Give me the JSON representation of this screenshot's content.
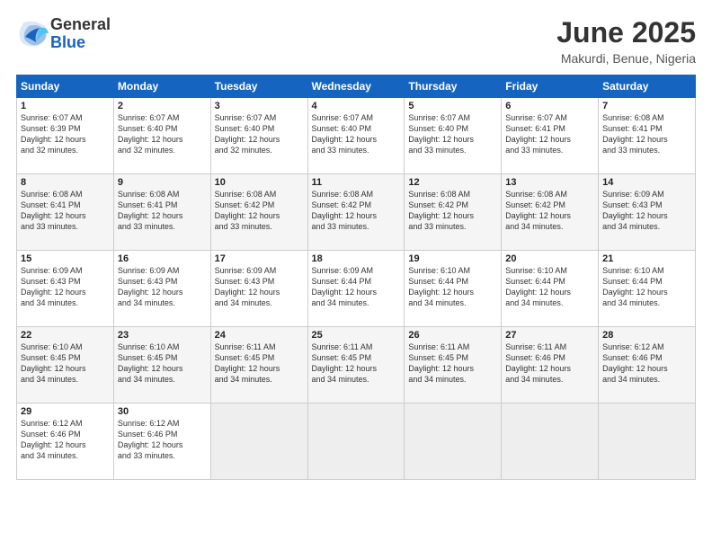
{
  "header": {
    "logo_general": "General",
    "logo_blue": "Blue",
    "month_year": "June 2025",
    "location": "Makurdi, Benue, Nigeria"
  },
  "days_of_week": [
    "Sunday",
    "Monday",
    "Tuesday",
    "Wednesday",
    "Thursday",
    "Friday",
    "Saturday"
  ],
  "weeks": [
    [
      {
        "day": "1",
        "info": "Sunrise: 6:07 AM\nSunset: 6:39 PM\nDaylight: 12 hours\nand 32 minutes."
      },
      {
        "day": "2",
        "info": "Sunrise: 6:07 AM\nSunset: 6:40 PM\nDaylight: 12 hours\nand 32 minutes."
      },
      {
        "day": "3",
        "info": "Sunrise: 6:07 AM\nSunset: 6:40 PM\nDaylight: 12 hours\nand 32 minutes."
      },
      {
        "day": "4",
        "info": "Sunrise: 6:07 AM\nSunset: 6:40 PM\nDaylight: 12 hours\nand 33 minutes."
      },
      {
        "day": "5",
        "info": "Sunrise: 6:07 AM\nSunset: 6:40 PM\nDaylight: 12 hours\nand 33 minutes."
      },
      {
        "day": "6",
        "info": "Sunrise: 6:07 AM\nSunset: 6:41 PM\nDaylight: 12 hours\nand 33 minutes."
      },
      {
        "day": "7",
        "info": "Sunrise: 6:08 AM\nSunset: 6:41 PM\nDaylight: 12 hours\nand 33 minutes."
      }
    ],
    [
      {
        "day": "8",
        "info": "Sunrise: 6:08 AM\nSunset: 6:41 PM\nDaylight: 12 hours\nand 33 minutes."
      },
      {
        "day": "9",
        "info": "Sunrise: 6:08 AM\nSunset: 6:41 PM\nDaylight: 12 hours\nand 33 minutes."
      },
      {
        "day": "10",
        "info": "Sunrise: 6:08 AM\nSunset: 6:42 PM\nDaylight: 12 hours\nand 33 minutes."
      },
      {
        "day": "11",
        "info": "Sunrise: 6:08 AM\nSunset: 6:42 PM\nDaylight: 12 hours\nand 33 minutes."
      },
      {
        "day": "12",
        "info": "Sunrise: 6:08 AM\nSunset: 6:42 PM\nDaylight: 12 hours\nand 33 minutes."
      },
      {
        "day": "13",
        "info": "Sunrise: 6:08 AM\nSunset: 6:42 PM\nDaylight: 12 hours\nand 34 minutes."
      },
      {
        "day": "14",
        "info": "Sunrise: 6:09 AM\nSunset: 6:43 PM\nDaylight: 12 hours\nand 34 minutes."
      }
    ],
    [
      {
        "day": "15",
        "info": "Sunrise: 6:09 AM\nSunset: 6:43 PM\nDaylight: 12 hours\nand 34 minutes."
      },
      {
        "day": "16",
        "info": "Sunrise: 6:09 AM\nSunset: 6:43 PM\nDaylight: 12 hours\nand 34 minutes."
      },
      {
        "day": "17",
        "info": "Sunrise: 6:09 AM\nSunset: 6:43 PM\nDaylight: 12 hours\nand 34 minutes."
      },
      {
        "day": "18",
        "info": "Sunrise: 6:09 AM\nSunset: 6:44 PM\nDaylight: 12 hours\nand 34 minutes."
      },
      {
        "day": "19",
        "info": "Sunrise: 6:10 AM\nSunset: 6:44 PM\nDaylight: 12 hours\nand 34 minutes."
      },
      {
        "day": "20",
        "info": "Sunrise: 6:10 AM\nSunset: 6:44 PM\nDaylight: 12 hours\nand 34 minutes."
      },
      {
        "day": "21",
        "info": "Sunrise: 6:10 AM\nSunset: 6:44 PM\nDaylight: 12 hours\nand 34 minutes."
      }
    ],
    [
      {
        "day": "22",
        "info": "Sunrise: 6:10 AM\nSunset: 6:45 PM\nDaylight: 12 hours\nand 34 minutes."
      },
      {
        "day": "23",
        "info": "Sunrise: 6:10 AM\nSunset: 6:45 PM\nDaylight: 12 hours\nand 34 minutes."
      },
      {
        "day": "24",
        "info": "Sunrise: 6:11 AM\nSunset: 6:45 PM\nDaylight: 12 hours\nand 34 minutes."
      },
      {
        "day": "25",
        "info": "Sunrise: 6:11 AM\nSunset: 6:45 PM\nDaylight: 12 hours\nand 34 minutes."
      },
      {
        "day": "26",
        "info": "Sunrise: 6:11 AM\nSunset: 6:45 PM\nDaylight: 12 hours\nand 34 minutes."
      },
      {
        "day": "27",
        "info": "Sunrise: 6:11 AM\nSunset: 6:46 PM\nDaylight: 12 hours\nand 34 minutes."
      },
      {
        "day": "28",
        "info": "Sunrise: 6:12 AM\nSunset: 6:46 PM\nDaylight: 12 hours\nand 34 minutes."
      }
    ],
    [
      {
        "day": "29",
        "info": "Sunrise: 6:12 AM\nSunset: 6:46 PM\nDaylight: 12 hours\nand 34 minutes."
      },
      {
        "day": "30",
        "info": "Sunrise: 6:12 AM\nSunset: 6:46 PM\nDaylight: 12 hours\nand 33 minutes."
      },
      {
        "day": "",
        "info": ""
      },
      {
        "day": "",
        "info": ""
      },
      {
        "day": "",
        "info": ""
      },
      {
        "day": "",
        "info": ""
      },
      {
        "day": "",
        "info": ""
      }
    ]
  ]
}
